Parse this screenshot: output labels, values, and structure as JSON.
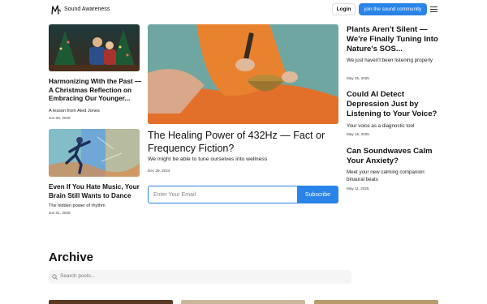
{
  "header": {
    "site_name": "Sound Awareness",
    "login_label": "Login",
    "join_label": "join the sound community",
    "accent_color": "#2a83e8"
  },
  "left_cards": [
    {
      "title": "Harmonizing With the Past — A Christmas Reflection on Embracing Our Younger...",
      "subtitle": "A lesson from Aled Jones",
      "date": "Jun 08, 2025"
    },
    {
      "title": "Even If You Hate Music, Your Brain Still Wants to Dance",
      "subtitle": "The hidden power of rhythm",
      "date": "Jun 01, 2025"
    }
  ],
  "feature": {
    "title": "The Healing Power of 432Hz — Fact or Frequency Fiction?",
    "subtitle": "We might be able to tune ourselves into wellness",
    "date": "Dec 29, 2024"
  },
  "subscribe": {
    "placeholder": "Enter Your Email",
    "button_label": "Subscribe"
  },
  "right_cards": [
    {
      "title": "Plants Aren't Silent — We're Finally Tuning Into Nature's SOS...",
      "subtitle": "We just haven't been listening properly",
      "date": "May 25, 2025"
    },
    {
      "title": "Could AI Detect Depression Just by Listening to Your Voice?",
      "subtitle": "Your voice as a diagnostic tool",
      "date": "May 18, 2025"
    },
    {
      "title": "Can Soundwaves Calm Your Anxiety?",
      "subtitle": "Meet your new calming companion: binaural beats",
      "date": "May 11, 2025"
    }
  ],
  "archive": {
    "title": "Archive",
    "search_placeholder": "Search posts..."
  }
}
